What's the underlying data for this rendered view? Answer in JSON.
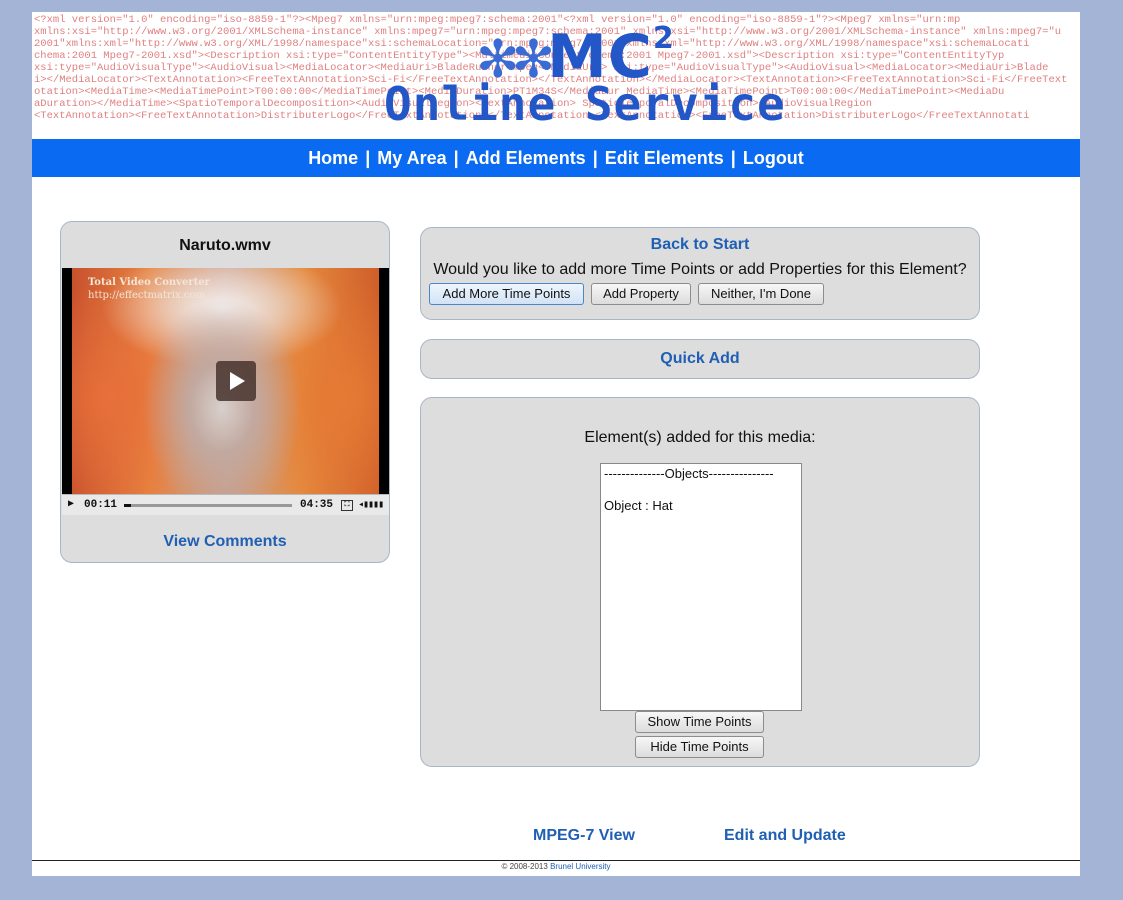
{
  "header": {
    "xml_lines": [
      "<?xml   version=\"1.0\"   encoding=\"iso-8859-1\"?><Mpeg7  xmlns=\"urn:mpeg:mpeg7:schema:2001\"<?xml   version=\"1.0\"   encoding=\"iso-8859-1\"?><Mpeg7  xmlns=\"urn:mp",
      "xmlns:xsi=\"http://www.w3.org/2001/XMLSchema-instance\" xmlns:mpeg7=\"urn:mpeg:mpeg7:schema:2001\" xmlns:xsi=\"http://www.w3.org/2001/XMLSchema-instance\" xmlns:mpeg7=\"u",
      "2001\"xmlns:xml=\"http://www.w3.org/XML/1998/namespace\"xsi:schemaLocation=\"urn:mpeg:mpeg7:s2001\"xmlns:xml=\"http://www.w3.org/XML/1998/namespace\"xsi:schemaLocati",
      "chema:2001  Mpeg7-2001.xsd\"><Description  xsi:type=\"ContentEntityType\"><MultimediaContent chema:2001  Mpeg7-2001.xsd\"><Description  xsi:type=\"ContentEntityTyp",
      "xsi:type=\"AudioVisualType\"><AudioVisual><MediaLocator><MediaUri>BladeRunner.mpeg</MediaUri> xsi:type=\"AudioVisualType\"><AudioVisual><MediaLocator><MediaUri>Blade",
      "i></MediaLocator><TextAnnotation><FreeTextAnnotation>Sci-Fi</FreeTextAnnotation></TextAnnotation></MediaLocator><TextAnnotation><FreeTextAnnotation>Sci-Fi</FreeText",
      "otation><MediaTime><MediaTimePoint>T00:00:00</MediaTimePoint><MediaDuration>PT1M34S</MediaDur MediaTime><MediaTimePoint>T00:00:00</MediaTimePoint><MediaDu",
      "aDuration></MediaTime><SpatioTemporalDecomposition><AudioVisualRegion><TextAnnotation> SpatioTemporalDecomposition><AudioVisualRegion",
      "<TextAnnotation><FreeTextAnnotation>DistributerLogo</FreeTextAnnotation></TextAnnotation><TextAnnotation><FreeTextAnnotation>DistributerLogo</FreeTextAnnotati"
    ],
    "logo_star": "✻✻",
    "logo_mc": "MC",
    "logo_sup": "2",
    "logo_subtitle": "Online Service"
  },
  "nav": {
    "items": [
      "Home",
      "My Area",
      "Add Elements",
      "Edit Elements",
      "Logout"
    ],
    "separator": "|"
  },
  "video": {
    "title": "Naruto.wmv",
    "watermark_name": "Total Video Converter",
    "watermark_url": "http://effectmatrix.com",
    "current_time": "00:11",
    "duration": "04:35",
    "progress": 0.04,
    "view_comments": "View Comments"
  },
  "options": {
    "back_to_start": "Back to Start",
    "question": "Would you like to add more Time Points or add Properties for this Element?",
    "add_more_time_points": "Add More Time Points",
    "add_property": "Add Property",
    "done": "Neither, I'm Done"
  },
  "quick_add": "Quick Add",
  "elements": {
    "heading": "Element(s) added for this media:",
    "list": [
      "--------------Objects---------------",
      "",
      "Object : Hat"
    ],
    "show_time_points": "Show Time Points",
    "hide_time_points": "Hide Time Points"
  },
  "footer": {
    "mpeg7_view": "MPEG-7 View",
    "edit_and_update": "Edit and Update",
    "copyright_prefix": "© 2008-2013",
    "copyright_link": "Brunel University"
  }
}
